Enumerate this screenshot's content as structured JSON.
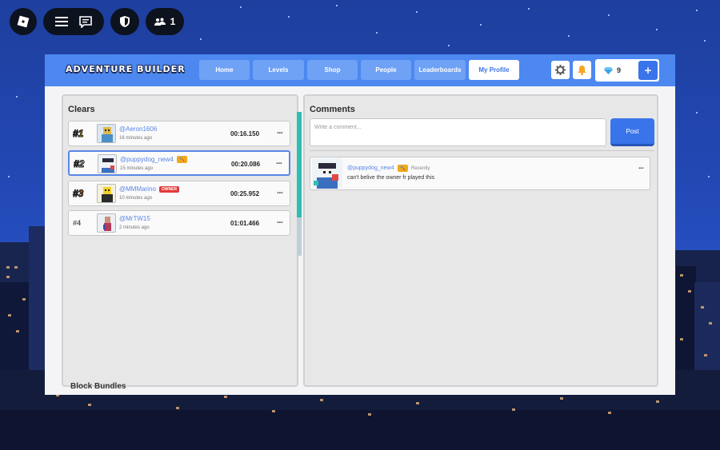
{
  "topbar": {
    "people_count": "1"
  },
  "app": {
    "logo": "ADVENTURE BUILDER"
  },
  "nav": [
    {
      "label": "Home"
    },
    {
      "label": "Levels"
    },
    {
      "label": "Shop"
    },
    {
      "label": "People"
    },
    {
      "label": "Leaderboards"
    },
    {
      "label": "My Profile",
      "active": true
    }
  ],
  "currency": {
    "gems": "9",
    "plus": "+"
  },
  "clears": {
    "title": "Clears",
    "rows": [
      {
        "rank": "#1",
        "user": "@Aeron1606",
        "ago": "16 minutes ago",
        "time": "00:16.150",
        "more": "..."
      },
      {
        "rank": "#2",
        "user": "@puppydog_new4",
        "ago": "15 minutes ago",
        "time": "00:20.086",
        "more": "...",
        "badge": "hammer"
      },
      {
        "rank": "#3",
        "user": "@MMMarino",
        "ago": "10 minutes ago",
        "time": "00:25.952",
        "more": "...",
        "badge": "OWNER"
      },
      {
        "rank": "#4",
        "user": "@MrTW15",
        "ago": "2 minutes ago",
        "time": "01:01.466",
        "more": "..."
      }
    ]
  },
  "comments": {
    "title": "Comments",
    "input_placeholder": "Write a comment...",
    "post_label": "Post",
    "items": [
      {
        "user": "@puppydog_new4",
        "when": "Recently",
        "text": "can't belive the owner fr played this",
        "more": "..."
      }
    ]
  },
  "footer": {
    "section_label": "Block Bundles"
  },
  "colors": {
    "accent": "#4d88f0",
    "button": "#3a74ea",
    "owner_badge": "#e23a3a",
    "builder_badge": "#f0a81c"
  }
}
